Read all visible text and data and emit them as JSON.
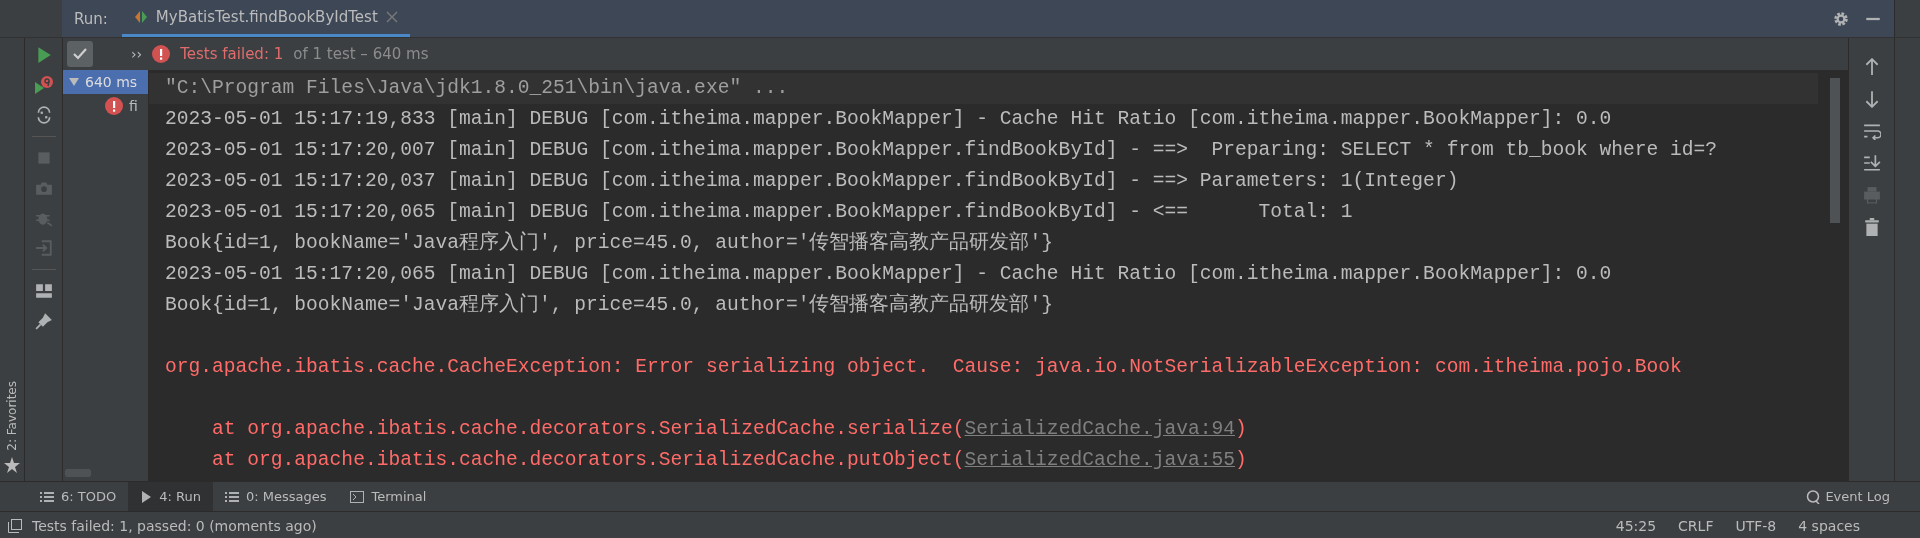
{
  "run_tab": {
    "prefix": "Run:",
    "title": "MyBatisTest.findBookByIdTest",
    "selected": true
  },
  "toolbar": {
    "show_passed": {
      "selected": true
    },
    "more": "››",
    "failed_label": "Tests failed: 1",
    "detail": "of 1 test – 640 ms"
  },
  "tree": [
    {
      "label": "640 ms",
      "selected": true,
      "expanded": true,
      "children": [
        {
          "label": "fi",
          "kind": "failed"
        }
      ]
    }
  ],
  "console": [
    {
      "kind": "command",
      "text": "\"C:\\Program Files\\Java\\jdk1.8.0_251\\bin\\java.exe\" ..."
    },
    {
      "kind": "normal",
      "text": "2023-05-01 15:17:19,833 [main] DEBUG [com.itheima.mapper.BookMapper] - Cache Hit Ratio [com.itheima.mapper.BookMapper]: 0.0"
    },
    {
      "kind": "normal",
      "text": "2023-05-01 15:17:20,007 [main] DEBUG [com.itheima.mapper.BookMapper.findBookById] - ==>  Preparing: SELECT * from tb_book where id=?"
    },
    {
      "kind": "normal",
      "text": "2023-05-01 15:17:20,037 [main] DEBUG [com.itheima.mapper.BookMapper.findBookById] - ==> Parameters: 1(Integer)"
    },
    {
      "kind": "normal",
      "text": "2023-05-01 15:17:20,065 [main] DEBUG [com.itheima.mapper.BookMapper.findBookById] - <==      Total: 1"
    },
    {
      "kind": "normal",
      "text": "Book{id=1, bookName='Java程序入门', price=45.0, author='传智播客高教产品研发部'}"
    },
    {
      "kind": "normal",
      "text": "2023-05-01 15:17:20,065 [main] DEBUG [com.itheima.mapper.BookMapper] - Cache Hit Ratio [com.itheima.mapper.BookMapper]: 0.0"
    },
    {
      "kind": "normal",
      "text": "Book{id=1, bookName='Java程序入门', price=45.0, author='传智播客高教产品研发部'}"
    },
    {
      "kind": "blank"
    },
    {
      "kind": "error",
      "text": "org.apache.ibatis.cache.CacheException: Error serializing object.  Cause: java.io.NotSerializableException: com.itheima.pojo.Book"
    },
    {
      "kind": "blank"
    },
    {
      "kind": "stack",
      "text": "    at org.apache.ibatis.cache.decorators.SerializedCache.serialize(",
      "link": "SerializedCache.java:94",
      "close": ")"
    },
    {
      "kind": "stack",
      "text": "    at org.apache.ibatis.cache.decorators.SerializedCache.putObject(",
      "link": "SerializedCache.java:55",
      "close": ")"
    }
  ],
  "favorites": "2: Favorites",
  "tool_tabs": [
    {
      "label": "6: TODO",
      "kind": "list",
      "selected": false
    },
    {
      "label": "4: Run",
      "kind": "run",
      "selected": true
    },
    {
      "label": "0: Messages",
      "kind": "list",
      "selected": false
    },
    {
      "label": "Terminal",
      "kind": "terminal",
      "selected": false
    }
  ],
  "event_log": "Event Log",
  "status_bar": {
    "message": "Tests failed: 1, passed: 0 (moments ago)",
    "items": [
      "45:25",
      "CRLF",
      "UTF-8",
      "4 spaces"
    ]
  }
}
